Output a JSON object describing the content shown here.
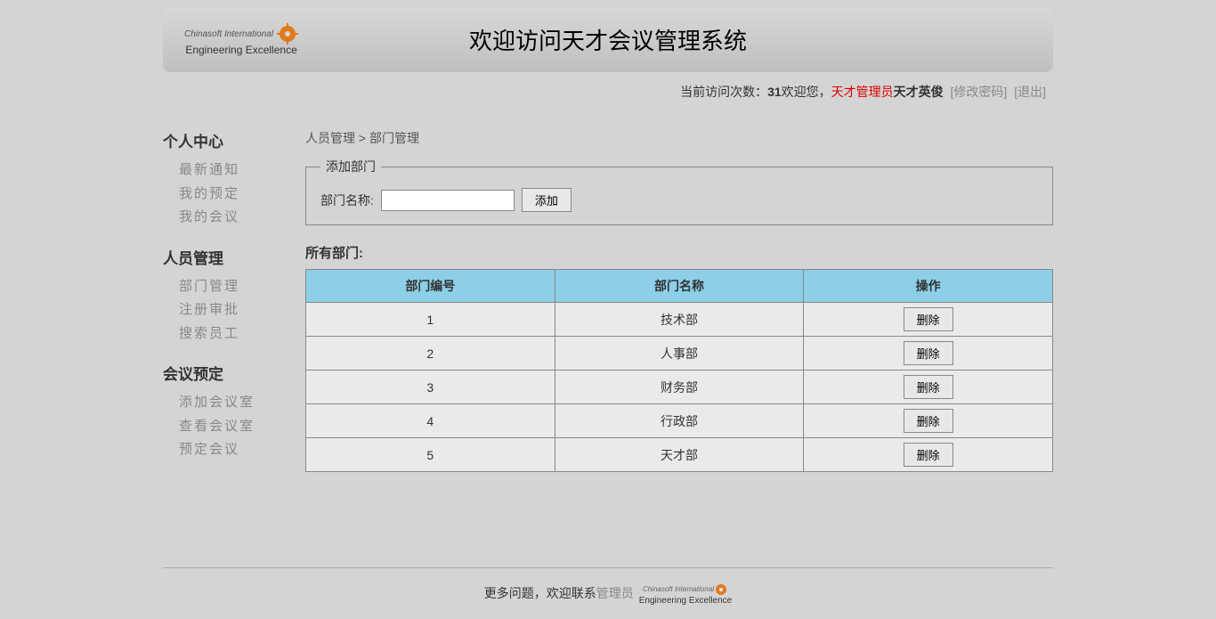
{
  "header": {
    "logo_top": "Chinasoft International",
    "logo_bottom": "Engineering Excellence",
    "title": "欢迎访问天才会议管理系统"
  },
  "topbar": {
    "visit_label": "当前访问次数：",
    "visit_count": "31",
    "welcome_label": "欢迎您，",
    "role": "天才管理员",
    "username": "天才英俊",
    "change_pwd": "[修改密码]",
    "logout": "[退出]"
  },
  "sidebar": {
    "sections": [
      {
        "title": "个人中心",
        "items": [
          "最新通知",
          "我的预定",
          "我的会议"
        ]
      },
      {
        "title": "人员管理",
        "items": [
          "部门管理",
          "注册审批",
          "搜索员工"
        ]
      },
      {
        "title": "会议预定",
        "items": [
          "添加会议室",
          "查看会议室",
          "预定会议"
        ]
      }
    ]
  },
  "breadcrumb": {
    "text": "人员管理 > 部门管理"
  },
  "form": {
    "legend": "添加部门",
    "label": "部门名称:",
    "button": "添加"
  },
  "all_dept_title": "所有部门:",
  "table": {
    "headers": [
      "部门编号",
      "部门名称",
      "操作"
    ],
    "rows": [
      {
        "id": "1",
        "name": "技术部",
        "action": "删除"
      },
      {
        "id": "2",
        "name": "人事部",
        "action": "删除"
      },
      {
        "id": "3",
        "name": "财务部",
        "action": "删除"
      },
      {
        "id": "4",
        "name": "行政部",
        "action": "删除"
      },
      {
        "id": "5",
        "name": "天才部",
        "action": "删除"
      }
    ]
  },
  "footer": {
    "text": "更多问题，欢迎联系",
    "link": "管理员",
    "logo_top": "Chinasoft International",
    "logo_bottom": "Engineering Excellence"
  }
}
